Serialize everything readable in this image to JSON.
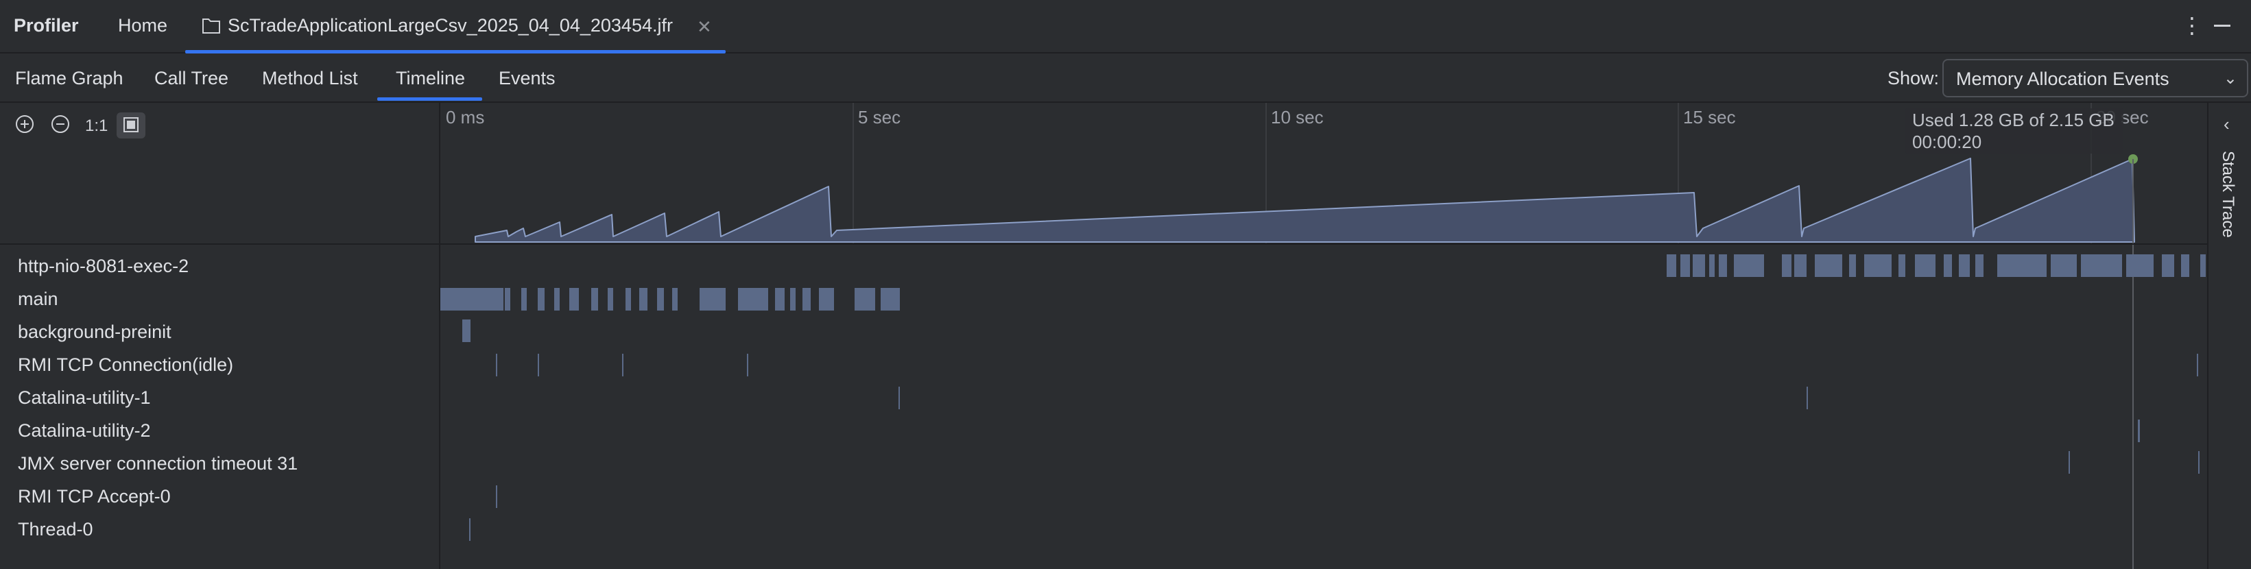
{
  "app_title": "Profiler",
  "tabs": {
    "home": "Home",
    "file": "ScTradeApplicationLargeCsv_2025_04_04_203454.jfr"
  },
  "view_tabs": [
    "Flame Graph",
    "Call Tree",
    "Method List",
    "Timeline",
    "Events"
  ],
  "active_view": "Timeline",
  "show": {
    "label": "Show:",
    "value": "Memory Allocation Events"
  },
  "zoom_controls": {
    "reset_label": "1:1"
  },
  "time_ticks": [
    "0 ms",
    "5 sec",
    "10 sec",
    "15 sec",
    "20 sec"
  ],
  "tooltip": {
    "line1": "Used 1.28 GB of 2.15 GB",
    "line2": "00:00:20"
  },
  "threads": [
    "http-nio-8081-exec-2",
    "main",
    "background-preinit",
    "RMI TCP Connection(idle)",
    "Catalina-utility-1",
    "Catalina-utility-2",
    "JMX server connection timeout 31",
    "RMI TCP Accept-0",
    "Thread-0"
  ],
  "right_panel": {
    "label": "Stack Trace"
  },
  "colors": {
    "background": "#2b2d30",
    "accent": "#3574f0",
    "memory_fill": "#46506a",
    "memory_line": "#8da0c8",
    "thread_activity": "#5b6a88",
    "cursor_dot": "#6d9a58"
  }
}
